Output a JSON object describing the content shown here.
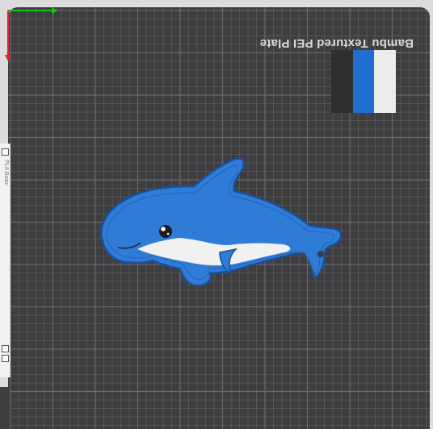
{
  "plate": {
    "label": "Bambu Textured PEI Plate"
  },
  "colors": {
    "plate_bg": "#3e3e40",
    "grid": "#5c5c5e",
    "grid_major": "#6a6a6c",
    "filament_1": "#2f2f2f",
    "filament_2": "#1f6fd1",
    "filament_3": "#ececec",
    "dolphin_blue": "#2f7bd8",
    "dolphin_outline": "#1a4f96",
    "dolphin_belly": "#f2f2f2",
    "axis_x": "#19c219",
    "axis_y": "#d42a2a"
  },
  "swatches": [
    {
      "name": "black-filament",
      "color": "#2f2f2f"
    },
    {
      "name": "blue-filament",
      "color": "#1f6fd1"
    },
    {
      "name": "white-filament",
      "color": "#ececec"
    }
  ],
  "left_panel": {
    "texts": [
      "PLA Basic"
    ]
  }
}
